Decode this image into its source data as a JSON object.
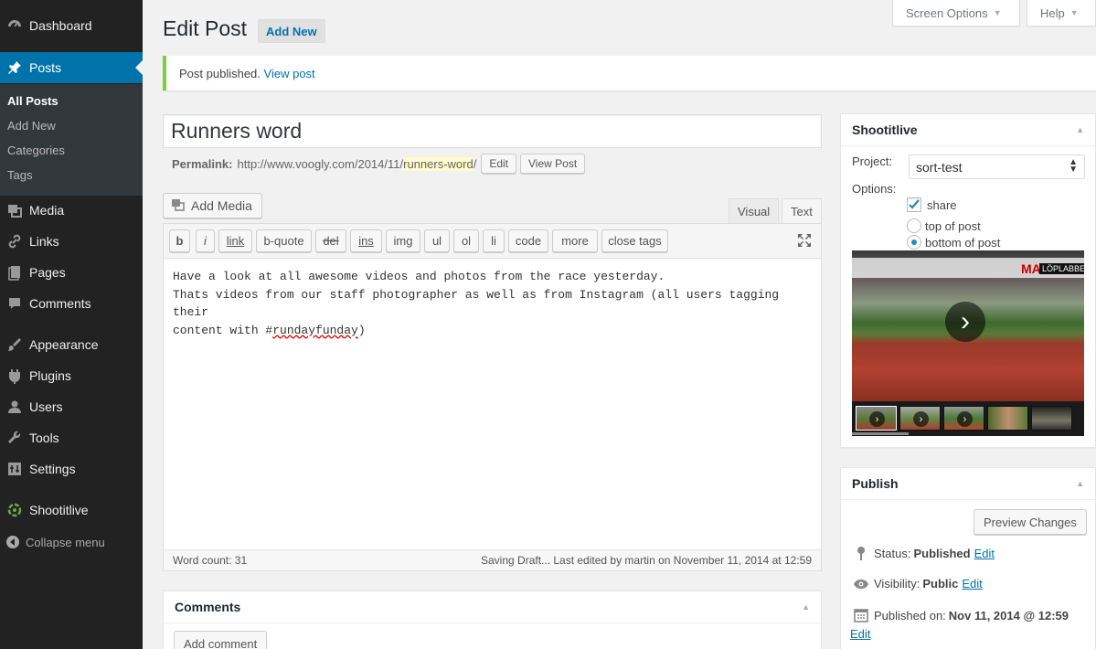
{
  "sidebar": {
    "items": [
      {
        "label": "Dashboard",
        "icon": "dashboard-icon"
      },
      {
        "label": "Posts",
        "icon": "pin-icon"
      },
      {
        "label": "Media",
        "icon": "media-icon"
      },
      {
        "label": "Links",
        "icon": "link-icon"
      },
      {
        "label": "Pages",
        "icon": "pages-icon"
      },
      {
        "label": "Comments",
        "icon": "comment-icon"
      },
      {
        "label": "Appearance",
        "icon": "brush-icon"
      },
      {
        "label": "Plugins",
        "icon": "plugin-icon"
      },
      {
        "label": "Users",
        "icon": "user-icon"
      },
      {
        "label": "Tools",
        "icon": "wrench-icon"
      },
      {
        "label": "Settings",
        "icon": "settings-icon"
      },
      {
        "label": "Shootitlive",
        "icon": "shootitlive-icon"
      }
    ],
    "submenu": [
      "All Posts",
      "Add New",
      "Categories",
      "Tags"
    ],
    "collapse_label": "Collapse menu"
  },
  "header": {
    "screen_options": "Screen Options",
    "help": "Help",
    "title": "Edit Post",
    "add_new": "Add New"
  },
  "notice": {
    "text": "Post published.",
    "link": "View post"
  },
  "post": {
    "title": "Runners word",
    "permalink_label": "Permalink:",
    "permalink_base": "http://www.voogly.com/2014/11/",
    "permalink_slug": "runners-word",
    "permalink_end": "/",
    "edit_btn": "Edit",
    "view_btn": "View Post"
  },
  "editor": {
    "add_media": "Add Media",
    "tab_visual": "Visual",
    "tab_text": "Text",
    "quicktags": [
      "b",
      "i",
      "link",
      "b-quote",
      "del",
      "ins",
      "img",
      "ul",
      "ol",
      "li",
      "code",
      "more",
      "close tags"
    ],
    "line1": "Have a look at all awesome videos and photos from the race yesterday.",
    "line2": "Thats videos from our staff photographer as well as from Instagram (all users tagging their",
    "line3_pre": "content with #",
    "line3_tag": "rundayfunday",
    "line3_post": ")",
    "word_count": "Word count: 31",
    "save_status": "Saving Draft... Last edited by martin on November 11, 2014 at 12:59"
  },
  "comments": {
    "title": "Comments",
    "add_button": "Add comment"
  },
  "shootitlive": {
    "title": "Shootitlive",
    "project_label": "Project:",
    "project_value": "sort-test",
    "options_label": "Options:",
    "share_label": "share",
    "share_checked": true,
    "top_label": "top of post",
    "bottom_label": "bottom of post",
    "position_selected": "bottom of post",
    "banner_text": "MAL",
    "banner_text_2": "LÖPLABBET"
  },
  "publish": {
    "title": "Publish",
    "preview_btn": "Preview Changes",
    "status_label": "Status:",
    "status_value": "Published",
    "visibility_label": "Visibility:",
    "visibility_value": "Public",
    "published_label": "Published on:",
    "published_value": "Nov 11, 2014 @ 12:59",
    "edit_link": "Edit"
  },
  "colors": {
    "accent": "#0073aa",
    "sidebar": "#222222",
    "notice_border": "#7ad03a"
  }
}
